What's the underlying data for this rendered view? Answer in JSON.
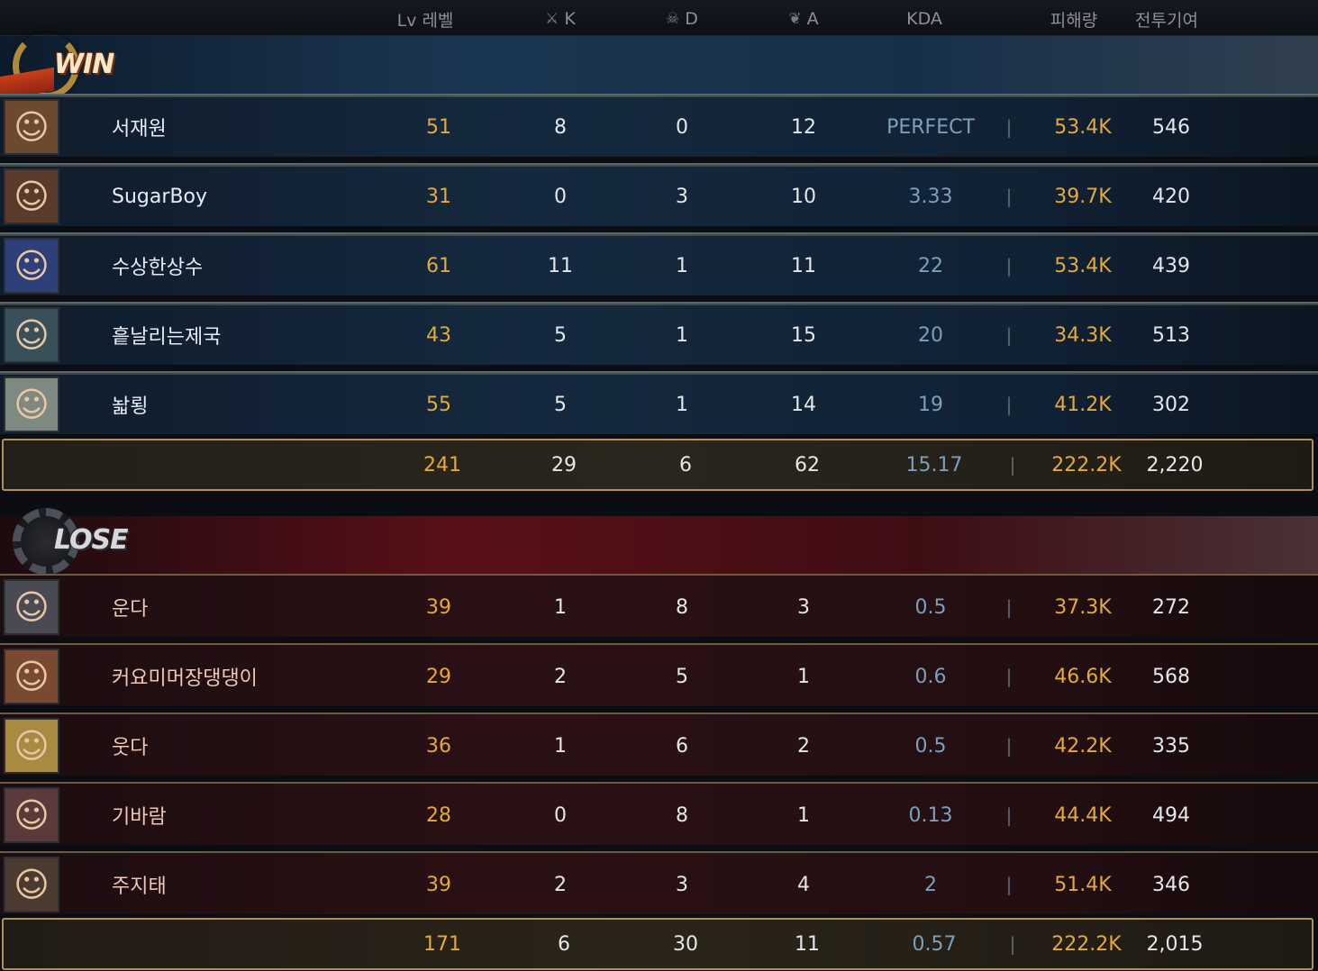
{
  "header": {
    "lv": "Lv 레벨",
    "k": "K",
    "d": "D",
    "a": "A",
    "kda": "KDA",
    "damage": "피해량",
    "contribution": "전투기여",
    "k_icon": "crossed-swords-icon",
    "d_icon": "skull-icon",
    "a_icon": "handshake-icon"
  },
  "win": {
    "label": "WIN",
    "players": [
      {
        "name": "서재원",
        "lv": "51",
        "k": "8",
        "d": "0",
        "a": "12",
        "kda": "PERFECT",
        "damage": "53.4K",
        "contribution": "546"
      },
      {
        "name": "SugarBoy",
        "lv": "31",
        "k": "0",
        "d": "3",
        "a": "10",
        "kda": "3.33",
        "damage": "39.7K",
        "contribution": "420"
      },
      {
        "name": "수상한상수",
        "lv": "61",
        "k": "11",
        "d": "1",
        "a": "11",
        "kda": "22",
        "damage": "53.4K",
        "contribution": "439"
      },
      {
        "name": "흩날리는제국",
        "lv": "43",
        "k": "5",
        "d": "1",
        "a": "15",
        "kda": "20",
        "damage": "34.3K",
        "contribution": "513"
      },
      {
        "name": "놟룅",
        "lv": "55",
        "k": "5",
        "d": "1",
        "a": "14",
        "kda": "19",
        "damage": "41.2K",
        "contribution": "302"
      }
    ],
    "total": {
      "lv": "241",
      "k": "29",
      "d": "6",
      "a": "62",
      "kda": "15.17",
      "damage": "222.2K",
      "contribution": "2,220"
    }
  },
  "lose": {
    "label": "LOSE",
    "players": [
      {
        "name": "운다",
        "lv": "39",
        "k": "1",
        "d": "8",
        "a": "3",
        "kda": "0.5",
        "damage": "37.3K",
        "contribution": "272"
      },
      {
        "name": "커요미머장댕댕이",
        "lv": "29",
        "k": "2",
        "d": "5",
        "a": "1",
        "kda": "0.6",
        "damage": "46.6K",
        "contribution": "568"
      },
      {
        "name": "웃다",
        "lv": "36",
        "k": "1",
        "d": "6",
        "a": "2",
        "kda": "0.5",
        "damage": "42.2K",
        "contribution": "335"
      },
      {
        "name": "기바람",
        "lv": "28",
        "k": "0",
        "d": "8",
        "a": "1",
        "kda": "0.13",
        "damage": "44.4K",
        "contribution": "494"
      },
      {
        "name": "주지태",
        "lv": "39",
        "k": "2",
        "d": "3",
        "a": "4",
        "kda": "2",
        "damage": "51.4K",
        "contribution": "346"
      }
    ],
    "total": {
      "lv": "171",
      "k": "6",
      "d": "30",
      "a": "11",
      "kda": "0.57",
      "damage": "222.2K",
      "contribution": "2,015"
    }
  },
  "separator": "|",
  "colors": {
    "gold": "#e5a93a",
    "kda_blue": "#7d9fba",
    "win_bg": "#15293e",
    "lose_bg": "#2a1114",
    "total_border": "#b39153"
  }
}
